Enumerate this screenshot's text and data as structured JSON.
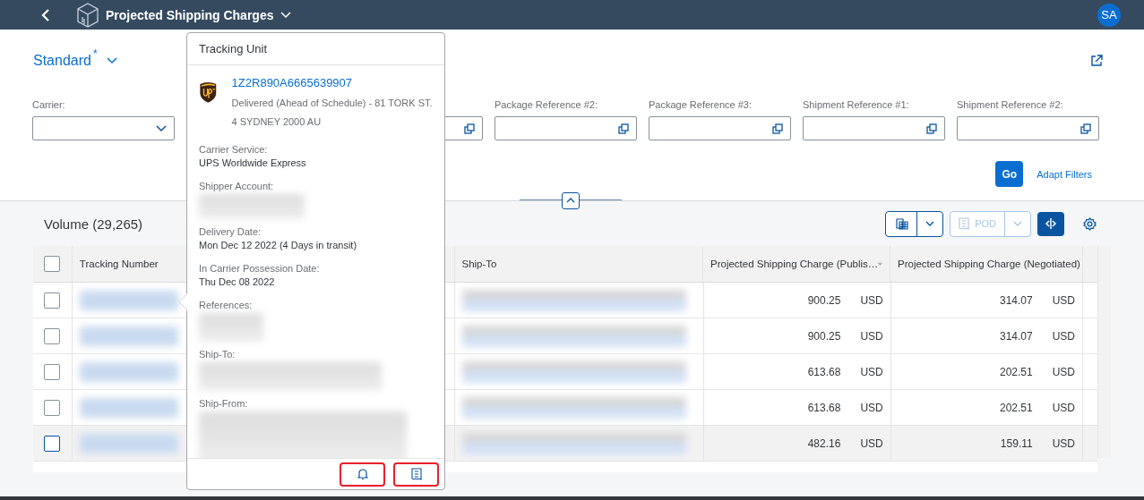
{
  "shell": {
    "title": "Projected Shipping Charges",
    "avatar": "SA"
  },
  "variant": {
    "name": "Standard",
    "modified_mark": "*"
  },
  "filters": [
    {
      "label": "Carrier:",
      "kind": "select"
    },
    {
      "kind": "value_help"
    },
    {
      "label": "Package Reference #2:",
      "kind": "value_help"
    },
    {
      "label": "Package Reference #3:",
      "kind": "value_help"
    },
    {
      "label": "Shipment Reference #1:",
      "kind": "value_help"
    },
    {
      "label": "Shipment Reference #2:",
      "kind": "value_help"
    }
  ],
  "filter_actions": {
    "go": "Go",
    "adapt": "Adapt Filters"
  },
  "table": {
    "title": "Volume (29,265)",
    "toolbar": {
      "pod": {
        "label": "POD",
        "disabled": true
      }
    },
    "select_all_checked": false,
    "columns": [
      {
        "label": "Tracking Number"
      },
      {
        "label": "Ship-To"
      },
      {
        "label": "Projected Shipping Charge (Publis…",
        "sortable": true
      },
      {
        "label": "Projected Shipping Charge (Negotiated)"
      }
    ],
    "rows": [
      {
        "checked": false,
        "selected": false,
        "published": "900.25",
        "published_currency": "USD",
        "negotiated": "314.07",
        "negotiated_currency": "USD"
      },
      {
        "checked": false,
        "selected": false,
        "published": "900.25",
        "published_currency": "USD",
        "negotiated": "314.07",
        "negotiated_currency": "USD"
      },
      {
        "checked": false,
        "selected": false,
        "published": "613.68",
        "published_currency": "USD",
        "negotiated": "202.51",
        "negotiated_currency": "USD"
      },
      {
        "checked": false,
        "selected": false,
        "published": "613.68",
        "published_currency": "USD",
        "negotiated": "202.51",
        "negotiated_currency": "USD"
      },
      {
        "checked": false,
        "selected": true,
        "published": "482.16",
        "published_currency": "USD",
        "negotiated": "159.11",
        "negotiated_currency": "USD"
      }
    ]
  },
  "popover": {
    "title": "Tracking Unit",
    "tracking_number": "1Z2R890A6665639907",
    "status": "Delivered (Ahead of Schedule) - 81 TORK ST. 4 SYDNEY 2000 AU",
    "fields": [
      {
        "label": "Carrier Service:",
        "kind": "text",
        "value": "UPS Worldwide Express"
      },
      {
        "label": "Shipper Account:",
        "kind": "blurred"
      },
      {
        "label": "Delivery Date:",
        "kind": "text",
        "value": "Mon Dec 12 2022 (4 Days in transit)"
      },
      {
        "label": "In Carrier Possession Date:",
        "kind": "text",
        "value": "Thu Dec 08 2022"
      },
      {
        "label": "References:",
        "kind": "blurred"
      },
      {
        "label": "Ship-To:",
        "kind": "blurred"
      },
      {
        "label": "Ship-From:",
        "kind": "blurred"
      }
    ]
  }
}
